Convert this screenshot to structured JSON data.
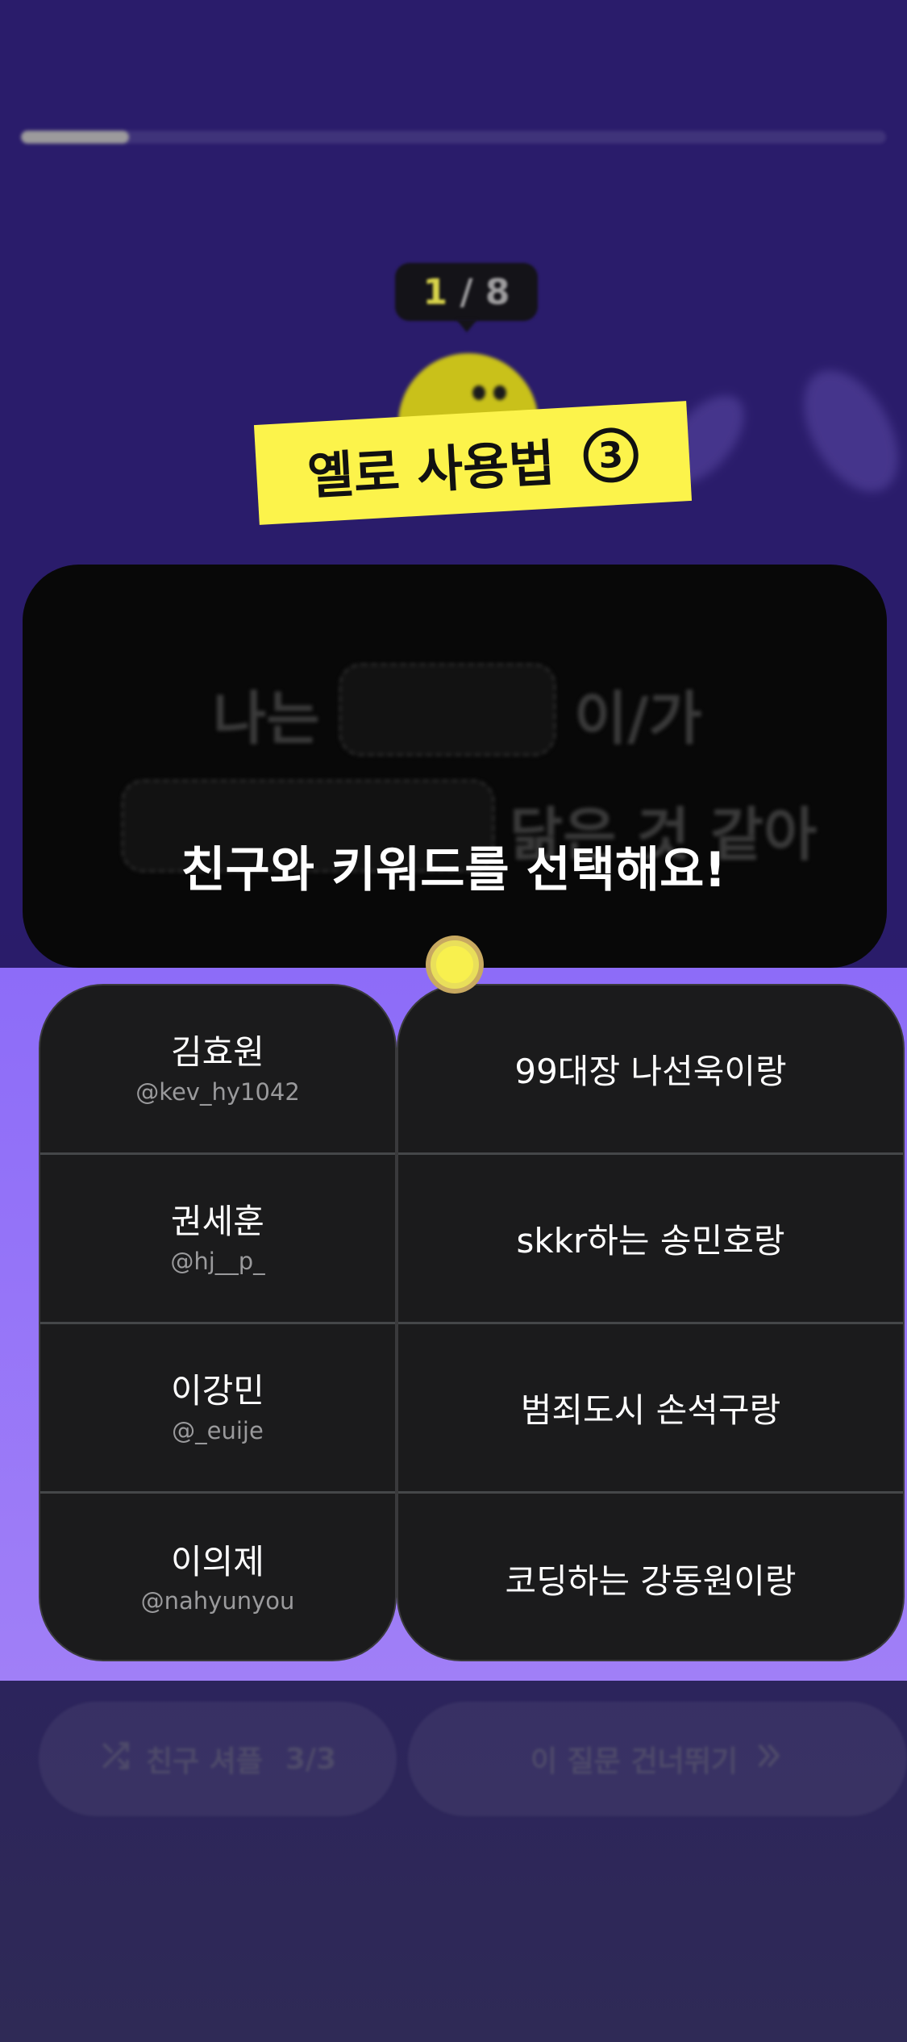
{
  "progress": {
    "fraction": 0.125
  },
  "question_counter": {
    "current": "1",
    "separator": " / ",
    "total": "8"
  },
  "tutorial": {
    "title": "옐로 사용법",
    "step": "3"
  },
  "question": {
    "line1_before": "나는",
    "line1_after": "이/가",
    "line2_after": "닮은 것 같아"
  },
  "instruction": "친구와 키워드를 선택해요!",
  "friends": [
    {
      "name": "김효원",
      "handle": "@kev_hy1042"
    },
    {
      "name": "권세훈",
      "handle": "@hj__p_"
    },
    {
      "name": "이강민",
      "handle": "@_euije"
    },
    {
      "name": "이의제",
      "handle": "@nahyunyou"
    }
  ],
  "keywords": [
    "99대장 나선욱이랑",
    "skkr하는 송민호랑",
    "범죄도시 손석구랑",
    "코딩하는 강동원이랑"
  ],
  "actions": {
    "shuffle_label": "친구 셔플",
    "shuffle_count": "3/3",
    "skip_label": "이 질문 건너뛰기"
  },
  "icons": {
    "shuffle": "shuffle-icon",
    "skip": "double-chevron-right-icon"
  },
  "colors": {
    "background": "#2a1c6b",
    "highlight": "#8d6cf8",
    "accent_yellow": "#fcf34b",
    "card": "#1b1b1c"
  }
}
